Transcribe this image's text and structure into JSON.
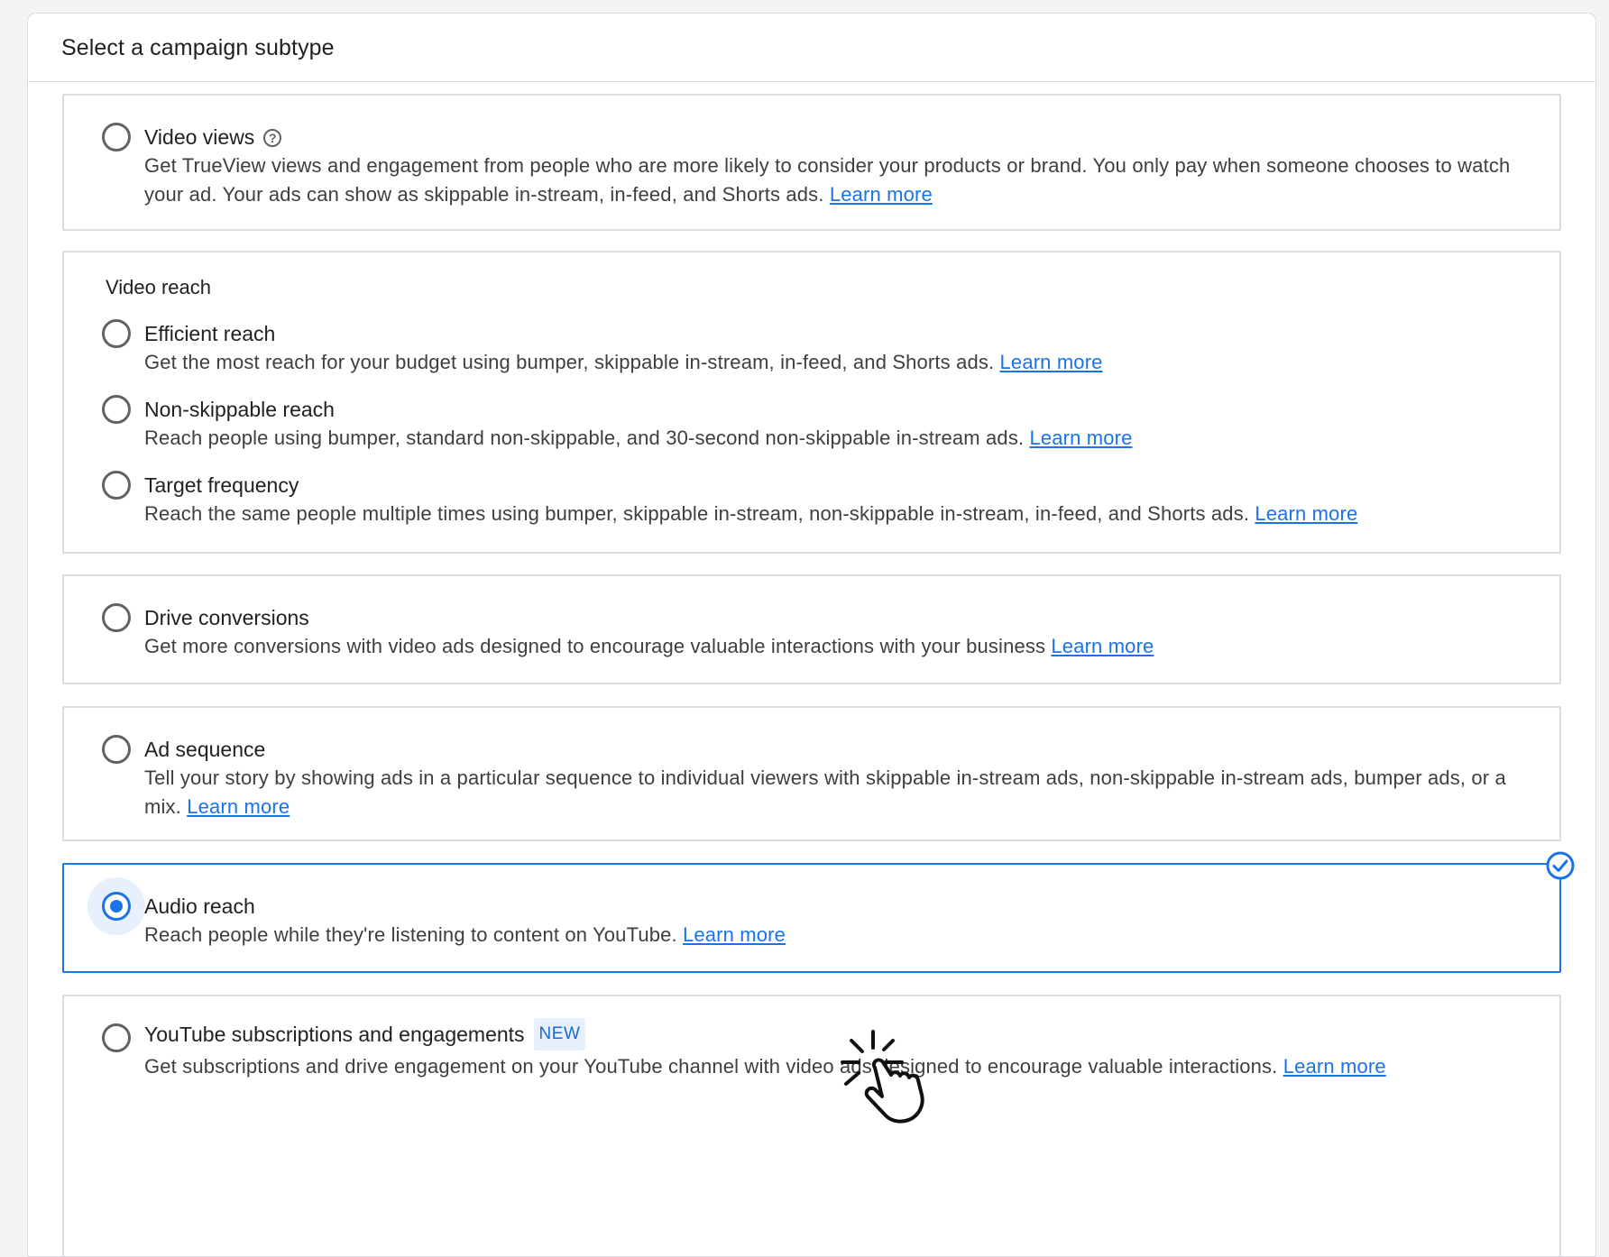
{
  "header": {
    "title": "Select a campaign subtype"
  },
  "learn_more": "Learn more",
  "options": {
    "video_views": {
      "title": "Video views",
      "description": "Get TrueView views and engagement from people who are more likely to consider your products or brand. You only pay when someone chooses to watch your ad. Your ads can show as skippable in-stream, in-feed, and Shorts ads."
    },
    "video_reach": {
      "label": "Video reach",
      "efficient": {
        "title": "Efficient reach",
        "description": "Get the most reach for your budget using bumper, skippable in-stream, in-feed, and Shorts ads."
      },
      "non_skippable": {
        "title": "Non-skippable reach",
        "description": "Reach people using bumper, standard non-skippable, and 30-second non-skippable in-stream ads."
      },
      "target_frequency": {
        "title": "Target frequency",
        "description": "Reach the same people multiple times using bumper, skippable in-stream, non-skippable in-stream, in-feed, and Shorts ads."
      }
    },
    "drive_conversions": {
      "title": "Drive conversions",
      "description": "Get more conversions with video ads designed to encourage valuable interactions with your business"
    },
    "ad_sequence": {
      "title": "Ad sequence",
      "description": "Tell your story by showing ads in a particular sequence to individual viewers with skippable in-stream ads, non-skippable in-stream ads, bumper ads, or a mix."
    },
    "audio_reach": {
      "title": "Audio reach",
      "description": "Reach people while they're listening to content on YouTube.",
      "selected": true
    },
    "youtube_subs": {
      "title": "YouTube subscriptions and engagements",
      "badge": "NEW",
      "description": "Get subscriptions and drive engagement on your YouTube channel with video ads designed to encourage valuable interactions."
    }
  },
  "colors": {
    "accent": "#1a73e8",
    "border": "#dadce0",
    "text": "#202124",
    "secondary_text": "#3c4043"
  }
}
